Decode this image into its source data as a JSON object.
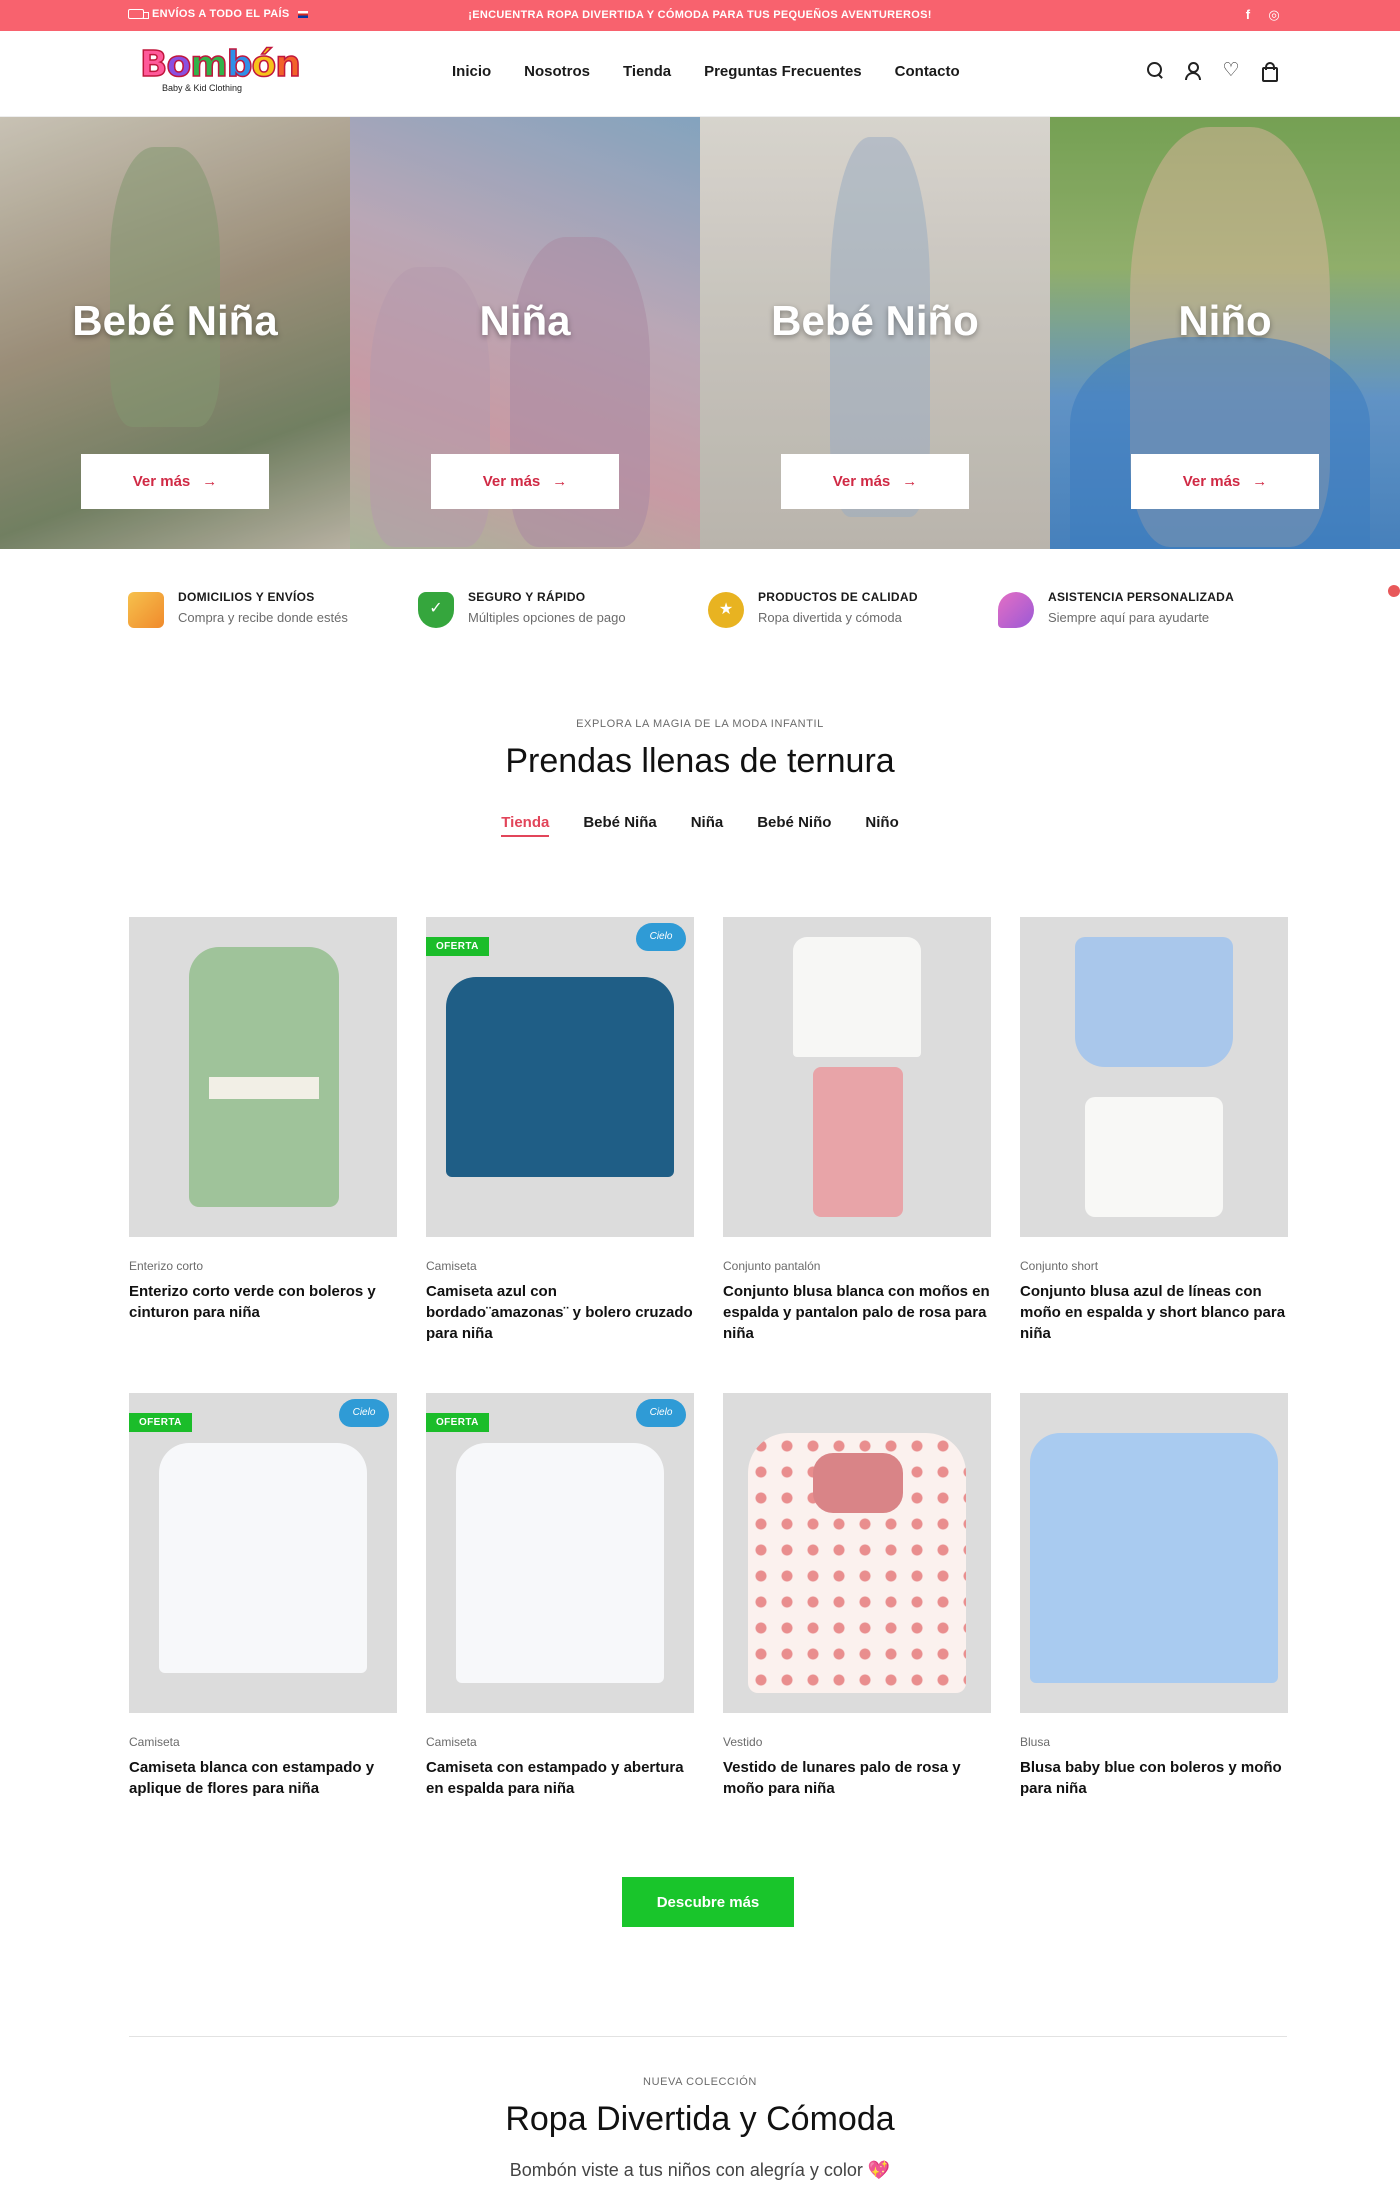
{
  "topbar": {
    "shipping": "ENVÍOS A TODO EL PAÍS",
    "promo": "¡ENCUENTRA ROPA DIVERTIDA Y CÓMODA PARA TUS PEQUEÑOS AVENTUREROS!",
    "social": [
      "f",
      "◎"
    ]
  },
  "header": {
    "logo_word": "Bombón",
    "logo_tagline": "Baby & Kid Clothing",
    "nav": [
      "Inicio",
      "Nosotros",
      "Tienda",
      "Preguntas Frecuentes",
      "Contacto"
    ],
    "icons": [
      "search-icon",
      "user-icon",
      "heart-icon",
      "bag-icon"
    ]
  },
  "hero": [
    {
      "title": "Bebé Niña",
      "button": "Ver más"
    },
    {
      "title": "Niña",
      "button": "Ver más"
    },
    {
      "title": "Bebé Niño",
      "button": "Ver más"
    },
    {
      "title": "Niño",
      "button": "Ver más"
    }
  ],
  "features": [
    {
      "title": "DOMICILIOS Y ENVÍOS",
      "text": "Compra y recibe donde estés",
      "color": "#f2a33a"
    },
    {
      "title": "SEGURO Y RÁPIDO",
      "text": "Múltiples opciones de pago",
      "color": "#35a63d"
    },
    {
      "title": "PRODUCTOS DE CALIDAD",
      "text": "Ropa divertida y cómoda",
      "color": "#e8b321"
    },
    {
      "title": "ASISTENCIA PERSONALIZADA",
      "text": "Siempre aquí para ayudarte",
      "color": "#d664b8"
    }
  ],
  "section1": {
    "kicker": "EXPLORA LA MAGIA DE LA MODA INFANTIL",
    "title": "Prendas llenas de ternura",
    "tabs": [
      "Tienda",
      "Bebé Niña",
      "Niña",
      "Bebé Niño",
      "Niño"
    ],
    "active_tab": "Tienda"
  },
  "products": [
    {
      "category": "Enterizo corto",
      "name": "Enterizo corto verde con boleros y cinturon para niña",
      "badge": "",
      "brand": ""
    },
    {
      "category": "Camiseta",
      "name": "Camiseta azul con bordado¨amazonas¨ y bolero cruzado para niña",
      "badge": "OFERTA",
      "brand": "Cielo"
    },
    {
      "category": "Conjunto pantalón",
      "name": "Conjunto blusa blanca con moños en espalda y pantalon palo de rosa para niña",
      "badge": "",
      "brand": ""
    },
    {
      "category": "Conjunto short",
      "name": "Conjunto blusa azul de líneas con moño en espalda y short blanco para niña",
      "badge": "",
      "brand": ""
    },
    {
      "category": "Camiseta",
      "name": "Camiseta blanca con estampado y aplique de flores para niña",
      "badge": "OFERTA",
      "brand": "Cielo"
    },
    {
      "category": "Camiseta",
      "name": "Camiseta con estampado y abertura en espalda para niña",
      "badge": "OFERTA",
      "brand": "Cielo"
    },
    {
      "category": "Vestido",
      "name": "Vestido de lunares palo de rosa y moño para niña",
      "badge": "",
      "brand": ""
    },
    {
      "category": "Blusa",
      "name": "Blusa baby blue con boleros y moño para niña",
      "badge": "",
      "brand": ""
    }
  ],
  "more_button": "Descubre más",
  "section2": {
    "kicker": "NUEVA COLECCIÓN",
    "title": "Ropa Divertida y Cómoda",
    "subtitle": "Bombón viste a tus niños con alegría y color 💖"
  }
}
